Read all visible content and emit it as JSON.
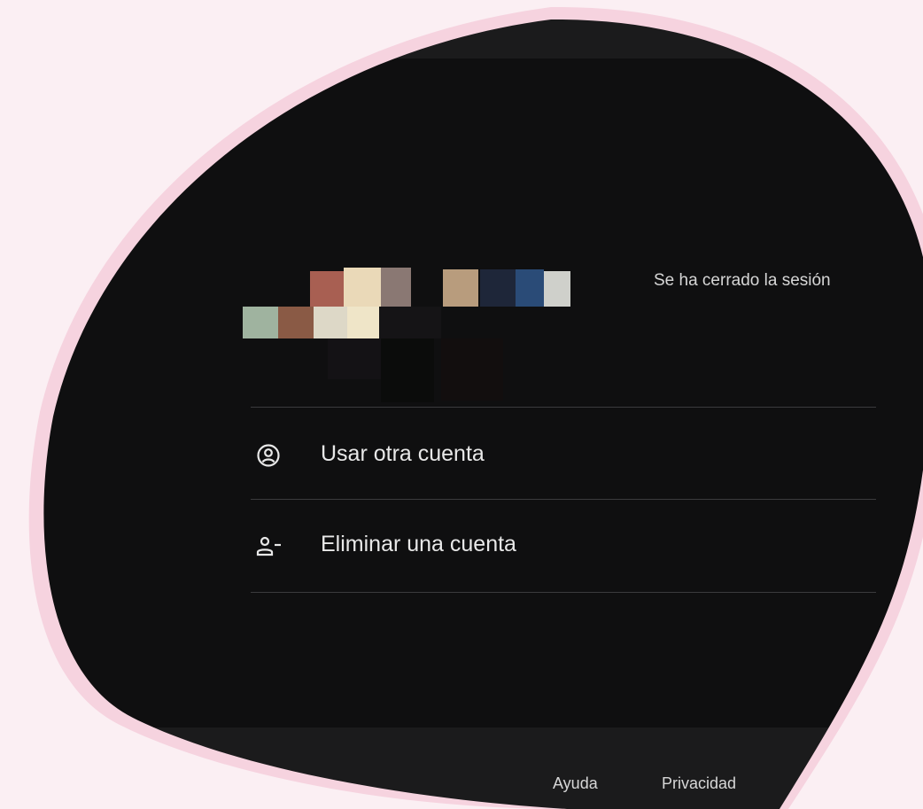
{
  "account": {
    "status": "Se ha cerrado la sesión"
  },
  "menu": {
    "use_other_account": {
      "label": "Usar otra cuenta",
      "icon": "account-circle-icon"
    },
    "remove_account": {
      "label": "Eliminar una cuenta",
      "icon": "person-remove-icon"
    }
  },
  "footer": {
    "help": "Ayuda",
    "privacy": "Privacidad"
  },
  "colors": {
    "background": "#fbeff3",
    "blob_border": "#f6d3df",
    "panel": "#0f0f10",
    "strip": "#1b1b1c",
    "divider": "#3b3b3d",
    "text_primary": "#e8e8e8"
  }
}
